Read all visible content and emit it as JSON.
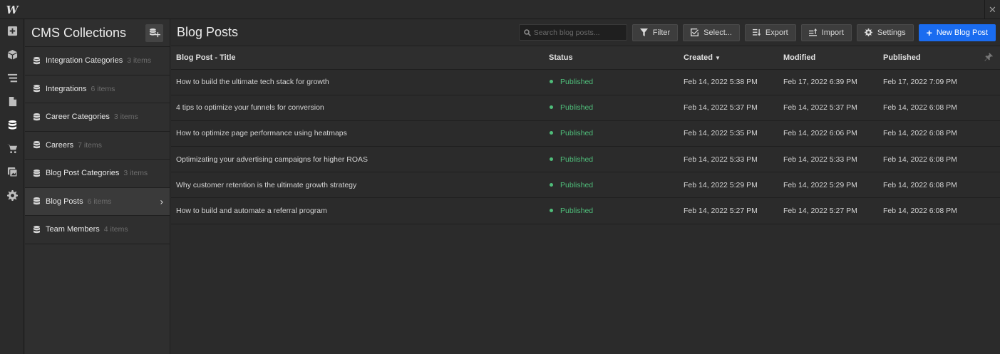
{
  "app": {
    "logo": "W",
    "close": "✕"
  },
  "rail": [
    "add-panel-icon",
    "components-icon",
    "navigator-icon",
    "pages-icon",
    "cms-icon",
    "ecommerce-icon",
    "assets-icon",
    "settings-icon"
  ],
  "collections": {
    "title": "CMS Collections",
    "items": [
      {
        "name": "Integration Categories",
        "count": "3 items"
      },
      {
        "name": "Integrations",
        "count": "6 items"
      },
      {
        "name": "Career Categories",
        "count": "3 items"
      },
      {
        "name": "Careers",
        "count": "7 items"
      },
      {
        "name": "Blog Post Categories",
        "count": "3 items"
      },
      {
        "name": "Blog Posts",
        "count": "6 items"
      },
      {
        "name": "Team Members",
        "count": "4 items"
      }
    ],
    "active_index": 5,
    "chevron": "›"
  },
  "main": {
    "title": "Blog Posts",
    "search_placeholder": "Search blog posts...",
    "buttons": {
      "filter": "Filter",
      "select": "Select...",
      "export": "Export",
      "import": "Import",
      "settings": "Settings",
      "new": "New Blog Post"
    }
  },
  "table": {
    "headers": {
      "title": "Blog Post - Title",
      "status": "Status",
      "created": "Created",
      "modified": "Modified",
      "published": "Published"
    },
    "sort_caret": "▼",
    "rows": [
      {
        "title": "How to build the ultimate tech stack for growth",
        "status": "Published",
        "created": "Feb 14, 2022 5:38 PM",
        "modified": "Feb 17, 2022 6:39 PM",
        "published": "Feb 17, 2022 7:09 PM"
      },
      {
        "title": "4 tips to optimize your funnels for conversion",
        "status": "Published",
        "created": "Feb 14, 2022 5:37 PM",
        "modified": "Feb 14, 2022 5:37 PM",
        "published": "Feb 14, 2022 6:08 PM"
      },
      {
        "title": "How to optimize page performance using heatmaps",
        "status": "Published",
        "created": "Feb 14, 2022 5:35 PM",
        "modified": "Feb 14, 2022 6:06 PM",
        "published": "Feb 14, 2022 6:08 PM"
      },
      {
        "title": "Optimizating your advertising campaigns for higher ROAS",
        "status": "Published",
        "created": "Feb 14, 2022 5:33 PM",
        "modified": "Feb 14, 2022 5:33 PM",
        "published": "Feb 14, 2022 6:08 PM"
      },
      {
        "title": "Why customer retention is the ultimate growth strategy",
        "status": "Published",
        "created": "Feb 14, 2022 5:29 PM",
        "modified": "Feb 14, 2022 5:29 PM",
        "published": "Feb 14, 2022 6:08 PM"
      },
      {
        "title": "How to build and automate a referral program",
        "status": "Published",
        "created": "Feb 14, 2022 5:27 PM",
        "modified": "Feb 14, 2022 5:27 PM",
        "published": "Feb 14, 2022 6:08 PM"
      }
    ]
  },
  "colors": {
    "accent": "#1a6cf0",
    "published": "#4fbd7a"
  }
}
